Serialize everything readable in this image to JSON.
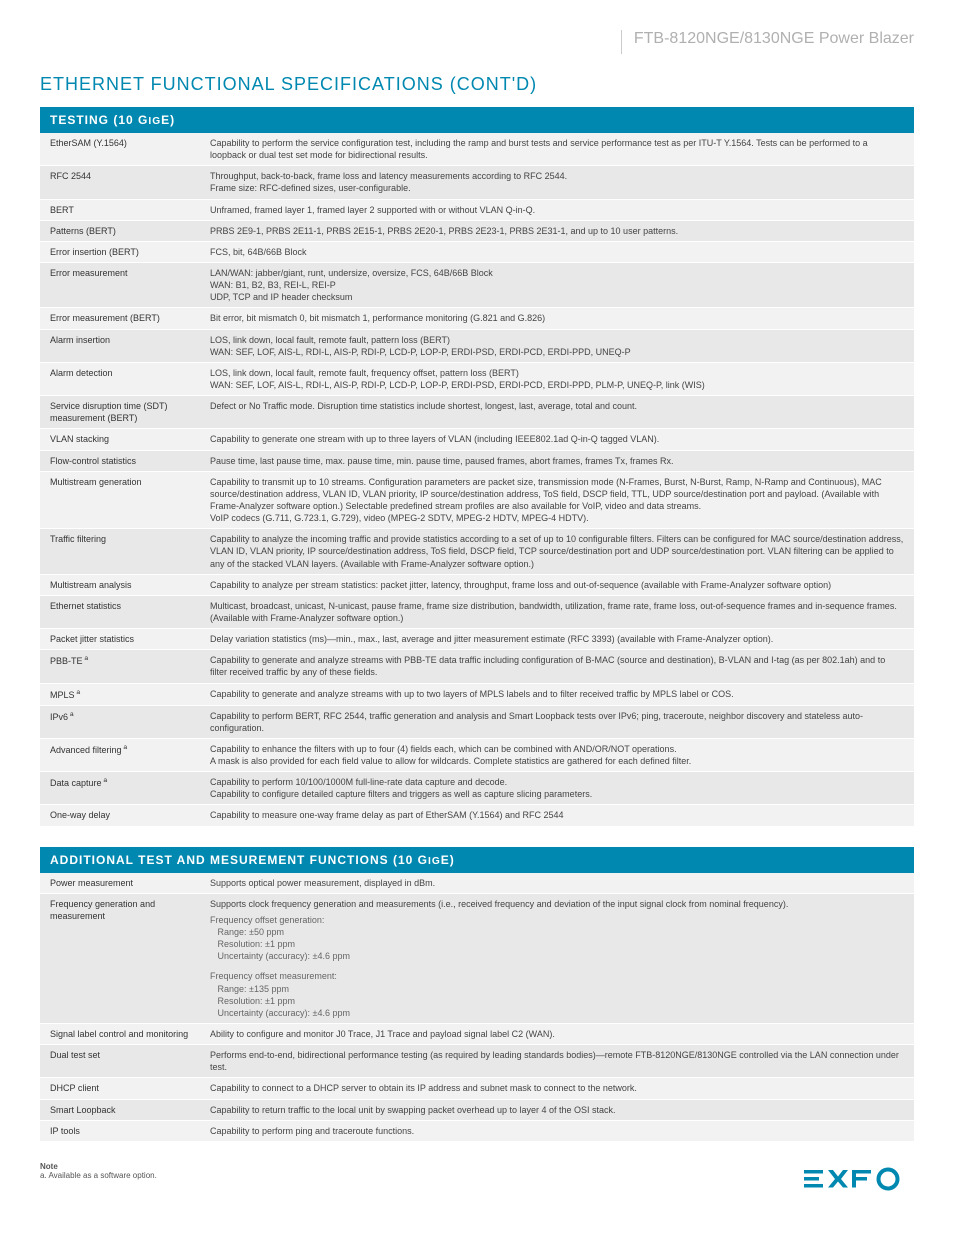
{
  "header": {
    "product": "FTB-8120NGE/8130NGE Power Blazer"
  },
  "section_title": "ETHERNET FUNCTIONAL SPECIFICATIONS (CONT'D)",
  "table1": {
    "header": "TESTING (10 GIGE)",
    "rows": [
      {
        "label": "EtherSAM (Y.1564)",
        "value": "Capability to perform the service configuration test, including the ramp and burst tests and service performance test as per ITU-T Y.1564. Tests can be performed to a loopback or dual test set mode for bidirectional results."
      },
      {
        "label": "RFC 2544",
        "value": "Throughput, back-to-back, frame loss and latency measurements according to RFC 2544.\nFrame size: RFC-defined sizes, user-configurable."
      },
      {
        "label": "BERT",
        "value": "Unframed, framed layer 1, framed layer 2 supported with or without VLAN Q-in-Q."
      },
      {
        "label": "Patterns (BERT)",
        "value": "PRBS 2E9-1, PRBS 2E11-1, PRBS 2E15-1, PRBS 2E20-1, PRBS 2E23-1, PRBS 2E31-1, and up to 10 user patterns."
      },
      {
        "label": "Error insertion (BERT)",
        "value": "FCS, bit, 64B/66B Block"
      },
      {
        "label": "Error measurement",
        "value": "LAN/WAN: jabber/giant, runt, undersize, oversize, FCS, 64B/66B Block\nWAN: B1, B2, B3, REI-L, REI-P\nUDP, TCP and IP header checksum"
      },
      {
        "label": "Error measurement (BERT)",
        "value": "Bit error, bit mismatch 0, bit mismatch 1, performance monitoring (G.821 and G.826)"
      },
      {
        "label": "Alarm insertion",
        "value": "LOS, link down, local fault, remote fault, pattern loss (BERT)\nWAN: SEF, LOF, AIS-L, RDI-L, AIS-P, RDI-P, LCD-P, LOP-P, ERDI-PSD, ERDI-PCD, ERDI-PPD, UNEQ-P"
      },
      {
        "label": "Alarm detection",
        "value": "LOS, link down, local fault, remote fault, frequency offset, pattern loss (BERT)\nWAN: SEF, LOF, AIS-L, RDI-L, AIS-P, RDI-P, LCD-P, LOP-P, ERDI-PSD, ERDI-PCD, ERDI-PPD, PLM-P, UNEQ-P, link (WIS)"
      },
      {
        "label": "Service disruption time (SDT) measurement (BERT)",
        "value": "Defect or No Traffic mode. Disruption time statistics include shortest, longest, last, average, total and count."
      },
      {
        "label": "VLAN stacking",
        "value": "Capability to generate one stream with up to three layers of VLAN (including IEEE802.1ad Q-in-Q tagged VLAN)."
      },
      {
        "label": "Flow-control statistics",
        "value": "Pause time, last pause time, max. pause time, min. pause time, paused frames, abort frames, frames Tx, frames Rx."
      },
      {
        "label": "Multistream generation",
        "value": "Capability to transmit up to 10 streams. Configuration parameters are packet size, transmission mode (N-Frames, Burst, N-Burst, Ramp, N-Ramp and Continuous), MAC source/destination address, VLAN ID, VLAN priority, IP source/destination address, ToS field, DSCP field, TTL, UDP source/destination port and payload. (Available with Frame-Analyzer software option.) Selectable predefined stream profiles are also available for VoIP, video and data streams.\nVoIP codecs (G.711, G.723.1, G.729), video (MPEG-2 SDTV, MPEG-2 HDTV, MPEG-4 HDTV)."
      },
      {
        "label": "Traffic filtering",
        "value": "Capability to analyze the incoming traffic and provide statistics according to a set of up to 10 configurable filters. Filters can be configured for MAC source/destination address, VLAN ID, VLAN priority, IP source/destination address, ToS field, DSCP field, TCP source/destination port and UDP source/destination port. VLAN filtering can be applied to any of the stacked VLAN layers. (Available with Frame-Analyzer software option.)"
      },
      {
        "label": "Multistream analysis",
        "value": "Capability to analyze per stream statistics: packet jitter, latency, throughput, frame loss and out-of-sequence (available with Frame-Analyzer software option)"
      },
      {
        "label": "Ethernet statistics",
        "value": "Multicast, broadcast, unicast, N-unicast, pause frame, frame size distribution, bandwidth, utilization, frame rate, frame loss, out-of-sequence frames and in-sequence frames. (Available with Frame-Analyzer software option.)"
      },
      {
        "label": "Packet jitter statistics",
        "value": "Delay variation statistics (ms)—min., max., last, average and jitter measurement estimate (RFC 3393) (available with Frame-Analyzer option)."
      },
      {
        "label": "PBB-TE",
        "note": "a",
        "value": "Capability to generate and analyze streams with PBB-TE data traffic including configuration of B-MAC (source and destination), B-VLAN and I-tag (as per 802.1ah) and to filter received traffic by any of these fields."
      },
      {
        "label": "MPLS",
        "note": "a",
        "value": "Capability to generate and analyze streams with up to two layers of MPLS labels and to filter received traffic by MPLS label or COS."
      },
      {
        "label": "IPv6",
        "note": "a",
        "value": "Capability to perform BERT, RFC 2544, traffic generation and analysis and Smart Loopback tests over IPv6; ping, traceroute, neighbor discovery and stateless auto-configuration."
      },
      {
        "label": "Advanced filtering",
        "note": "a",
        "value": "Capability to enhance the filters with up to four (4) fields each, which can be combined with AND/OR/NOT operations.\nA mask is also provided for each field value to allow for wildcards. Complete statistics are gathered for each defined filter."
      },
      {
        "label": "Data capture",
        "note": "a",
        "value": "Capability to perform 10/100/1000M full-line-rate data capture and decode.\nCapability to configure detailed capture filters and triggers as well as capture slicing parameters."
      },
      {
        "label": "One-way delay",
        "value": "Capability to measure one-way frame delay as part of EtherSAM (Y.1564) and RFC 2544"
      }
    ]
  },
  "table2": {
    "header": "ADDITIONAL TEST AND MESUREMENT FUNCTIONS (10 GIGE)",
    "rows": [
      {
        "label": "Power measurement",
        "value": "Supports optical power measurement, displayed in dBm."
      },
      {
        "label": "Frequency generation and measurement",
        "value": "Supports clock frequency generation and measurements (i.e., received frequency and deviation of the input signal clock from nominal frequency).",
        "sub1": "Frequency offset generation:\n   Range: ±50 ppm\n   Resolution: ±1 ppm\n   Uncertainty (accuracy): ±4.6 ppm",
        "sub2": "Frequency offset measurement:\n   Range: ±135 ppm\n   Resolution: ±1 ppm\n   Uncertainty (accuracy): ±4.6 ppm"
      },
      {
        "label": "Signal label control and monitoring",
        "value": "Ability to configure and monitor J0 Trace, J1 Trace and payload signal label C2 (WAN)."
      },
      {
        "label": "Dual test set",
        "value": "Performs end-to-end, bidirectional performance testing (as required by leading standards bodies)—remote FTB-8120NGE/8130NGE controlled via the LAN connection under test."
      },
      {
        "label": "DHCP client",
        "value": "Capability to connect to a DHCP server to obtain its IP address and subnet mask to connect to the network."
      },
      {
        "label": "Smart Loopback",
        "value": "Capability to return traffic to the local unit by swapping packet overhead up to layer 4 of the OSI stack."
      },
      {
        "label": "IP tools",
        "value": "Capability to perform ping and traceroute functions."
      }
    ]
  },
  "note": {
    "head": "Note",
    "text": "a. Available as a software option."
  },
  "logo_text": "EXFO"
}
